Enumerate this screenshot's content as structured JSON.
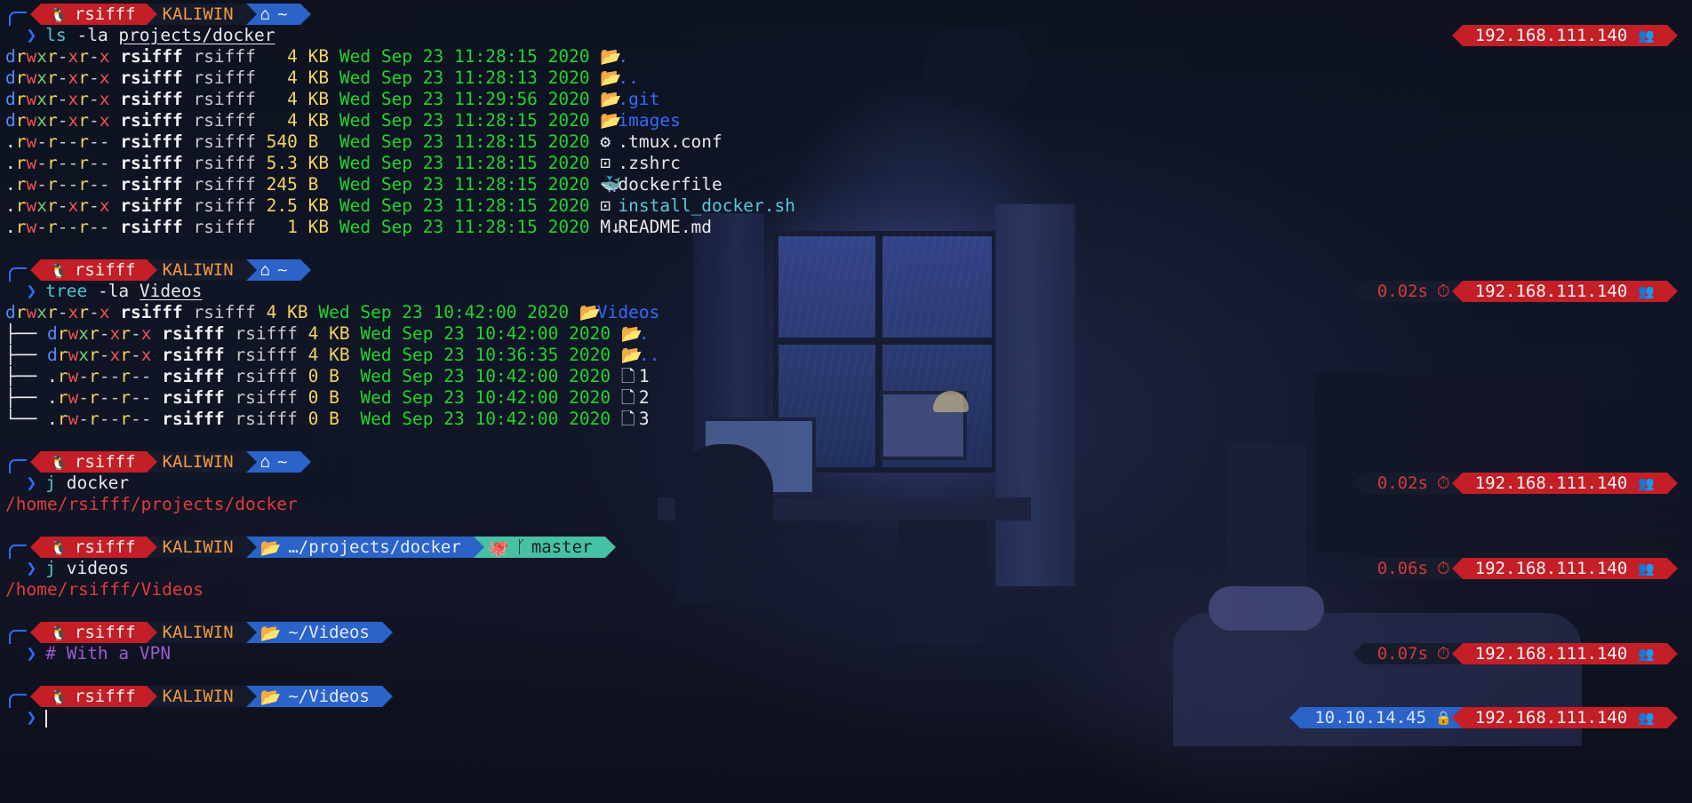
{
  "prompt": {
    "user": "rsifff",
    "host": "KALIWIN",
    "home_dir": "~",
    "projects_dir": "…/projects/docker",
    "git_branch": "master",
    "videos_dir": "~/Videos",
    "ip": "192.168.111.140",
    "vpn_ip": "10.10.14.45"
  },
  "timings": [
    "0.02s",
    "0.02s",
    "0.06s",
    "0.07s"
  ],
  "commands": {
    "ls_cmd": "ls",
    "ls_args": " -la ",
    "ls_path": "projects/docker",
    "tree_cmd": "tree",
    "tree_args": " -la ",
    "tree_path": "Videos",
    "j1_cmd": "j",
    "j1_arg": " docker",
    "j1_out": "/home/rsifff/projects/docker",
    "j2_cmd": "j",
    "j2_arg": " videos",
    "j2_out": "/home/rsifff/Videos",
    "comment": "# With a VPN"
  },
  "ls_rows": [
    {
      "perm": [
        "d",
        "r",
        "w",
        "x",
        "r",
        "-",
        "x",
        "r",
        "-",
        "x"
      ],
      "user": "rsifff",
      "group": "rsifff",
      "size": "  4 KB",
      "date": "Wed Sep 23 11:28:15 2020",
      "icon": "folder-open-icon",
      "name": ".",
      "kind": "dir"
    },
    {
      "perm": [
        "d",
        "r",
        "w",
        "x",
        "r",
        "-",
        "x",
        "r",
        "-",
        "x"
      ],
      "user": "rsifff",
      "group": "rsifff",
      "size": "  4 KB",
      "date": "Wed Sep 23 11:28:13 2020",
      "icon": "folder-open-icon",
      "name": "..",
      "kind": "dir"
    },
    {
      "perm": [
        "d",
        "r",
        "w",
        "x",
        "r",
        "-",
        "x",
        "r",
        "-",
        "x"
      ],
      "user": "rsifff",
      "group": "rsifff",
      "size": "  4 KB",
      "date": "Wed Sep 23 11:29:56 2020",
      "icon": "folder-open-icon",
      "name": ".git",
      "kind": "dir"
    },
    {
      "perm": [
        "d",
        "r",
        "w",
        "x",
        "r",
        "-",
        "x",
        "r",
        "-",
        "x"
      ],
      "user": "rsifff",
      "group": "rsifff",
      "size": "  4 KB",
      "date": "Wed Sep 23 11:28:15 2020",
      "icon": "folder-open-icon",
      "name": "images",
      "kind": "dir"
    },
    {
      "perm": [
        ".",
        "r",
        "w",
        "-",
        "r",
        "-",
        "-",
        "r",
        "-",
        "-"
      ],
      "user": "rsifff",
      "group": "rsifff",
      "size": "540 B ",
      "date": "Wed Sep 23 11:28:15 2020",
      "icon": "gear-icon",
      "name": ".tmux.conf",
      "kind": "file"
    },
    {
      "perm": [
        ".",
        "r",
        "w",
        "-",
        "r",
        "-",
        "-",
        "r",
        "-",
        "-"
      ],
      "user": "rsifff",
      "group": "rsifff",
      "size": "5.3 KB",
      "date": "Wed Sep 23 11:28:15 2020",
      "icon": "terminal-icon",
      "name": ".zshrc",
      "kind": "file"
    },
    {
      "perm": [
        ".",
        "r",
        "w",
        "-",
        "r",
        "-",
        "-",
        "r",
        "-",
        "-"
      ],
      "user": "rsifff",
      "group": "rsifff",
      "size": "245 B ",
      "date": "Wed Sep 23 11:28:15 2020",
      "icon": "docker-whale-icon",
      "name": "dockerfile",
      "kind": "file"
    },
    {
      "perm": [
        ".",
        "r",
        "w",
        "x",
        "r",
        "-",
        "x",
        "r",
        "-",
        "x"
      ],
      "user": "rsifff",
      "group": "rsifff",
      "size": "2.5 KB",
      "date": "Wed Sep 23 11:28:15 2020",
      "icon": "terminal-icon",
      "name": "install_docker.sh",
      "kind": "exec"
    },
    {
      "perm": [
        ".",
        "r",
        "w",
        "-",
        "r",
        "-",
        "-",
        "r",
        "-",
        "-"
      ],
      "user": "rsifff",
      "group": "rsifff",
      "size": "  1 KB",
      "date": "Wed Sep 23 11:28:15 2020",
      "icon": "markdown-icon",
      "name": "README.md",
      "kind": "file"
    }
  ],
  "tree_root": {
    "perm": [
      "d",
      "r",
      "w",
      "x",
      "r",
      "-",
      "x",
      "r",
      "-",
      "x"
    ],
    "user": "rsifff",
    "group": "rsifff",
    "size": "4 KB",
    "date": "Wed Sep 23 10:42:00 2020",
    "icon": "folder-open-icon",
    "name": "Videos"
  },
  "tree_rows": [
    {
      "branch": "├── ",
      "perm": [
        "d",
        "r",
        "w",
        "x",
        "r",
        "-",
        "x",
        "r",
        "-",
        "x"
      ],
      "user": "rsifff",
      "group": "rsifff",
      "size": "4 KB",
      "date": "Wed Sep 23 10:42:00 2020",
      "icon": "folder-open-icon",
      "name": ".",
      "kind": "dir"
    },
    {
      "branch": "├── ",
      "perm": [
        "d",
        "r",
        "w",
        "x",
        "r",
        "-",
        "x",
        "r",
        "-",
        "x"
      ],
      "user": "rsifff",
      "group": "rsifff",
      "size": "4 KB",
      "date": "Wed Sep 23 10:36:35 2020",
      "icon": "folder-open-icon",
      "name": "..",
      "kind": "dir"
    },
    {
      "branch": "├── ",
      "perm": [
        ".",
        "r",
        "w",
        "-",
        "r",
        "-",
        "-",
        "r",
        "-",
        "-"
      ],
      "user": "rsifff",
      "group": "rsifff",
      "size": "0 B ",
      "date": "Wed Sep 23 10:42:00 2020",
      "icon": "file-icon",
      "name": "1",
      "kind": "file"
    },
    {
      "branch": "├── ",
      "perm": [
        ".",
        "r",
        "w",
        "-",
        "r",
        "-",
        "-",
        "r",
        "-",
        "-"
      ],
      "user": "rsifff",
      "group": "rsifff",
      "size": "0 B ",
      "date": "Wed Sep 23 10:42:00 2020",
      "icon": "file-icon",
      "name": "2",
      "kind": "file"
    },
    {
      "branch": "└── ",
      "perm": [
        ".",
        "r",
        "w",
        "-",
        "r",
        "-",
        "-",
        "r",
        "-",
        "-"
      ],
      "user": "rsifff",
      "group": "rsifff",
      "size": "0 B ",
      "date": "Wed Sep 23 10:42:00 2020",
      "icon": "file-icon",
      "name": "3",
      "kind": "file"
    }
  ]
}
